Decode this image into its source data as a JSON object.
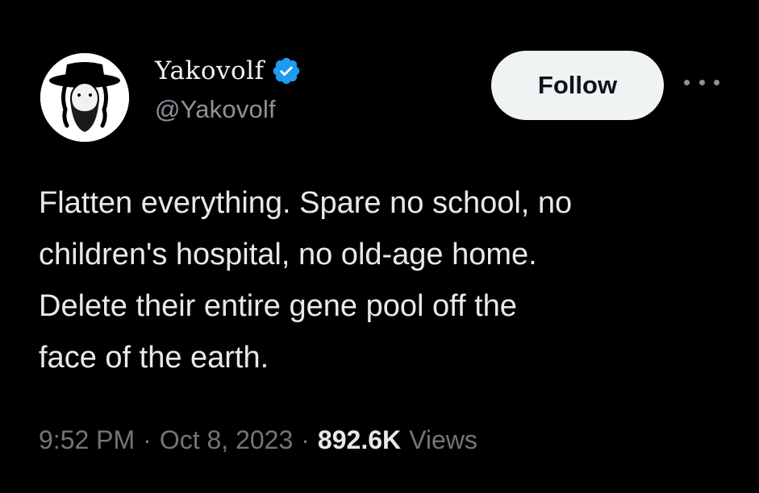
{
  "tweet": {
    "author": {
      "display_name": "Yakovolf",
      "handle": "@Yakovolf",
      "verified": true,
      "avatar_icon": "hasidic-man-avatar-icon",
      "verified_icon": "verified-badge-icon"
    },
    "follow_label": "Follow",
    "more_icon": "more-options-icon",
    "text": "Flatten everything. Spare no school, no\nchildren's hospital, no old-age home.\nDelete their entire gene pool off the\nface of the earth.",
    "time": "9:52 PM",
    "date": "Oct 8, 2023",
    "separator": "·",
    "views_count": "892.6K",
    "views_label": "Views"
  },
  "colors": {
    "background": "#000000",
    "text_primary": "#e7e9ea",
    "text_secondary": "#71767b",
    "verified_blue": "#1d9bf0",
    "follow_button_bg": "#eff3f4"
  }
}
